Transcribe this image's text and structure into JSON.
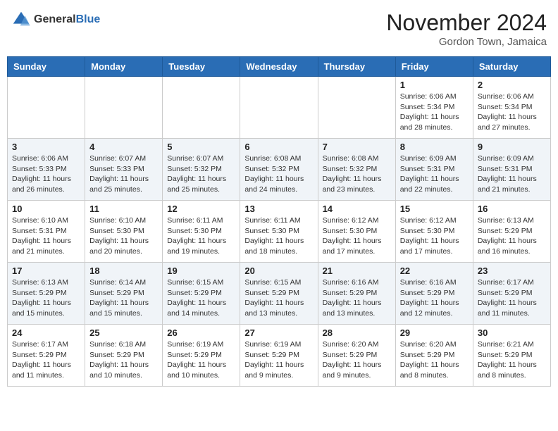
{
  "header": {
    "logo_general": "General",
    "logo_blue": "Blue",
    "month_title": "November 2024",
    "location": "Gordon Town, Jamaica"
  },
  "weekdays": [
    "Sunday",
    "Monday",
    "Tuesday",
    "Wednesday",
    "Thursday",
    "Friday",
    "Saturday"
  ],
  "weeks": [
    [
      {
        "day": "",
        "info": ""
      },
      {
        "day": "",
        "info": ""
      },
      {
        "day": "",
        "info": ""
      },
      {
        "day": "",
        "info": ""
      },
      {
        "day": "",
        "info": ""
      },
      {
        "day": "1",
        "info": "Sunrise: 6:06 AM\nSunset: 5:34 PM\nDaylight: 11 hours and 28 minutes."
      },
      {
        "day": "2",
        "info": "Sunrise: 6:06 AM\nSunset: 5:34 PM\nDaylight: 11 hours and 27 minutes."
      }
    ],
    [
      {
        "day": "3",
        "info": "Sunrise: 6:06 AM\nSunset: 5:33 PM\nDaylight: 11 hours and 26 minutes."
      },
      {
        "day": "4",
        "info": "Sunrise: 6:07 AM\nSunset: 5:33 PM\nDaylight: 11 hours and 25 minutes."
      },
      {
        "day": "5",
        "info": "Sunrise: 6:07 AM\nSunset: 5:32 PM\nDaylight: 11 hours and 25 minutes."
      },
      {
        "day": "6",
        "info": "Sunrise: 6:08 AM\nSunset: 5:32 PM\nDaylight: 11 hours and 24 minutes."
      },
      {
        "day": "7",
        "info": "Sunrise: 6:08 AM\nSunset: 5:32 PM\nDaylight: 11 hours and 23 minutes."
      },
      {
        "day": "8",
        "info": "Sunrise: 6:09 AM\nSunset: 5:31 PM\nDaylight: 11 hours and 22 minutes."
      },
      {
        "day": "9",
        "info": "Sunrise: 6:09 AM\nSunset: 5:31 PM\nDaylight: 11 hours and 21 minutes."
      }
    ],
    [
      {
        "day": "10",
        "info": "Sunrise: 6:10 AM\nSunset: 5:31 PM\nDaylight: 11 hours and 21 minutes."
      },
      {
        "day": "11",
        "info": "Sunrise: 6:10 AM\nSunset: 5:30 PM\nDaylight: 11 hours and 20 minutes."
      },
      {
        "day": "12",
        "info": "Sunrise: 6:11 AM\nSunset: 5:30 PM\nDaylight: 11 hours and 19 minutes."
      },
      {
        "day": "13",
        "info": "Sunrise: 6:11 AM\nSunset: 5:30 PM\nDaylight: 11 hours and 18 minutes."
      },
      {
        "day": "14",
        "info": "Sunrise: 6:12 AM\nSunset: 5:30 PM\nDaylight: 11 hours and 17 minutes."
      },
      {
        "day": "15",
        "info": "Sunrise: 6:12 AM\nSunset: 5:30 PM\nDaylight: 11 hours and 17 minutes."
      },
      {
        "day": "16",
        "info": "Sunrise: 6:13 AM\nSunset: 5:29 PM\nDaylight: 11 hours and 16 minutes."
      }
    ],
    [
      {
        "day": "17",
        "info": "Sunrise: 6:13 AM\nSunset: 5:29 PM\nDaylight: 11 hours and 15 minutes."
      },
      {
        "day": "18",
        "info": "Sunrise: 6:14 AM\nSunset: 5:29 PM\nDaylight: 11 hours and 15 minutes."
      },
      {
        "day": "19",
        "info": "Sunrise: 6:15 AM\nSunset: 5:29 PM\nDaylight: 11 hours and 14 minutes."
      },
      {
        "day": "20",
        "info": "Sunrise: 6:15 AM\nSunset: 5:29 PM\nDaylight: 11 hours and 13 minutes."
      },
      {
        "day": "21",
        "info": "Sunrise: 6:16 AM\nSunset: 5:29 PM\nDaylight: 11 hours and 13 minutes."
      },
      {
        "day": "22",
        "info": "Sunrise: 6:16 AM\nSunset: 5:29 PM\nDaylight: 11 hours and 12 minutes."
      },
      {
        "day": "23",
        "info": "Sunrise: 6:17 AM\nSunset: 5:29 PM\nDaylight: 11 hours and 11 minutes."
      }
    ],
    [
      {
        "day": "24",
        "info": "Sunrise: 6:17 AM\nSunset: 5:29 PM\nDaylight: 11 hours and 11 minutes."
      },
      {
        "day": "25",
        "info": "Sunrise: 6:18 AM\nSunset: 5:29 PM\nDaylight: 11 hours and 10 minutes."
      },
      {
        "day": "26",
        "info": "Sunrise: 6:19 AM\nSunset: 5:29 PM\nDaylight: 11 hours and 10 minutes."
      },
      {
        "day": "27",
        "info": "Sunrise: 6:19 AM\nSunset: 5:29 PM\nDaylight: 11 hours and 9 minutes."
      },
      {
        "day": "28",
        "info": "Sunrise: 6:20 AM\nSunset: 5:29 PM\nDaylight: 11 hours and 9 minutes."
      },
      {
        "day": "29",
        "info": "Sunrise: 6:20 AM\nSunset: 5:29 PM\nDaylight: 11 hours and 8 minutes."
      },
      {
        "day": "30",
        "info": "Sunrise: 6:21 AM\nSunset: 5:29 PM\nDaylight: 11 hours and 8 minutes."
      }
    ]
  ]
}
